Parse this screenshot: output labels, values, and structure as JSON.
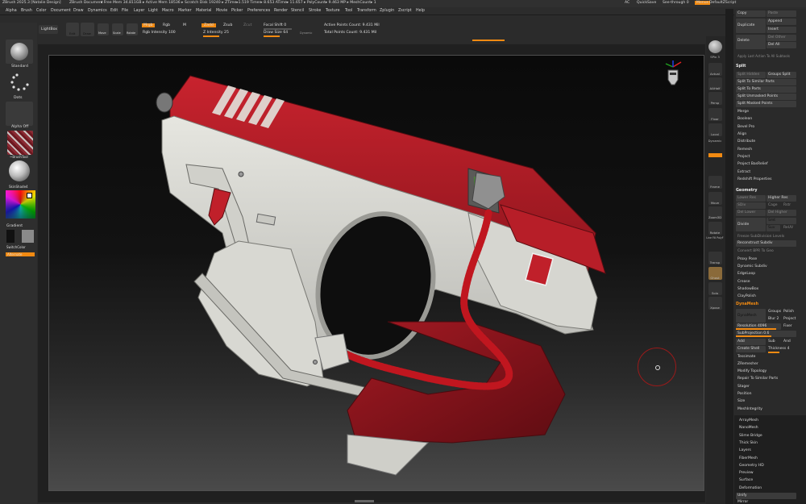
{
  "title_bar": {
    "app": "ZBrush 2025.3 [Natalie Design]",
    "document": "ZBrush Document",
    "stats": "▸ Free Mem 34.811GB ▸ Active Mem 18536 ▸ Scratch Disk 19240 ▸ ZTime▸1.519 Timer▸ 8.653 ATime▸ 11.657 ▸ PolyCount▸ 9.463 MP ▸ MeshCount▸ 1",
    "ac": "AC",
    "quicksave": "QuickSave",
    "seethrough": "See-through  0",
    "menus": "Menus",
    "script": "DefaultZScript"
  },
  "menu": [
    "Alpha",
    "Brush",
    "Color",
    "Document",
    "Draw",
    "Dynamics",
    "Edit",
    "File",
    "Layer",
    "Light",
    "Macro",
    "Marker",
    "Material",
    "Movie",
    "Picker",
    "Preferences",
    "Render",
    "Stencil",
    "Stroke",
    "Texture",
    "Tool",
    "Transform",
    "Zplugin",
    "Zscript",
    "Help"
  ],
  "shelf": {
    "projection_master": "Projection Master",
    "lightbox": "LightBox",
    "edit": "Edit",
    "draw": "Draw",
    "move": "Move",
    "scale": "Scale",
    "rotate": "Rotate",
    "mrgb": "Mrgb",
    "rgb": "Rgb",
    "m": "M",
    "rgb_intensity": "Rgb Intensity 100",
    "zadd": "Zadd",
    "zsub": "Zsub",
    "zcut": "Zcut",
    "z_intensity": "Z Intensity 25",
    "focal_shift": "Focal Shift 0",
    "draw_size": "Draw Size 64",
    "dynamic": "Dynamic",
    "active_points": "Active Points Count: 9.431 Mil",
    "total_points": "Total Points Count: 9.431 Mil"
  },
  "left_bar": {
    "standard": "Standard",
    "dots": "Dots",
    "alpha_off": "Alpha Off",
    "brush_tool": "~BrushTool",
    "skin_shaded": "SkinShade4",
    "gradient": "Gradient",
    "switch_color": "SwitchColor",
    "alternate": "Alternate"
  },
  "right_shelf": [
    "SPix 3",
    "Actual",
    "AAHalf",
    "Persp",
    "Floor",
    "Local",
    "Dynamic",
    "Frame",
    "Move",
    "Zoom3D",
    "Rotate",
    "Line Fill PolyF",
    "Transp",
    "Ghost",
    "Solo",
    "Xpose"
  ],
  "tray": {
    "copy": "Copy",
    "paste": "Paste",
    "duplicate": "Duplicate",
    "append": "Append",
    "insert": "Insert",
    "delete": "Delete",
    "del_other": "Del Other",
    "del_all": "Del All",
    "apply_last": "Apply Last Action To All Subtools",
    "split_header": "Split",
    "split_hidden": "Split Hidden",
    "groups_split": "Groups Split",
    "split_to_similar": "Split To Similar Parts",
    "split_to_parts": "Split To Parts",
    "split_unmasked": "Split Unmasked Points",
    "split_masked": "Split Masked Points",
    "merge": "Merge",
    "boolean": "Boolean",
    "bevel_pro": "Bevel Pro",
    "align": "Align",
    "distribute": "Distribute",
    "remesh": "Remesh",
    "project": "Project",
    "project_basrelief": "Project BasRelief",
    "extract": "Extract",
    "redshift": "Redshift Properties",
    "geometry_header": "Geometry",
    "lower_res": "Lower Res",
    "higher_res": "Higher Res",
    "sdiv": "SDiv",
    "cage": "Cage",
    "rstr": "Rstr",
    "del_lower": "Del Lower",
    "del_higher": "Del Higher",
    "divide": "Divide",
    "smt": "Smt",
    "suv": "Suv",
    "reuv": "ReUV",
    "freeze": "Freeze SubDivision Levels",
    "reconstruct": "Reconstruct Subdiv",
    "convert_bpr": "Convert BPR To Geo",
    "proxy_pose": "Proxy Pose",
    "dynamic_subdiv": "Dynamic Subdiv",
    "edgeloop": "EdgeLoop",
    "crease": "Crease",
    "shadowbox": "ShadowBox",
    "claypolish": "ClayPolish",
    "dynamesh_header": "DynaMesh",
    "dynamesh": "DynaMesh",
    "groups": "Groups",
    "polish": "Polish",
    "blur": "Blur 2",
    "project2": "Project",
    "resolution": "Resolution 4096",
    "fixer": "Fixer",
    "subprojection": "SubProjection 0.6",
    "add": "Add",
    "sub": "Sub",
    "and": "And",
    "create_shell": "Create Shell",
    "thickness": "Thickness 4",
    "tessimate": "Tessimate",
    "zremesher": "ZRemesher",
    "modify_topology": "Modify Topology",
    "repair_similar": "Repair To Similar Parts",
    "stager": "Stager",
    "position": "Position",
    "size": "Size",
    "meshintegrity": "MeshIntegrity",
    "arraymesh": "ArrayMesh",
    "nanomesh": "NanoMesh",
    "slime_bridge": "Slime Bridge",
    "thick_skin": "Thick Skin",
    "layers": "Layers",
    "fibermesh": "FiberMesh",
    "geometry_hd": "Geometry HD",
    "preview": "Preview",
    "surface": "Surface",
    "deformation": "Deformation",
    "unify": "Unify",
    "mirror": "Mirror"
  },
  "colors": {
    "accent": "#f18a12",
    "gun_red": "#b71e28",
    "gun_white": "#d8d8d2"
  }
}
